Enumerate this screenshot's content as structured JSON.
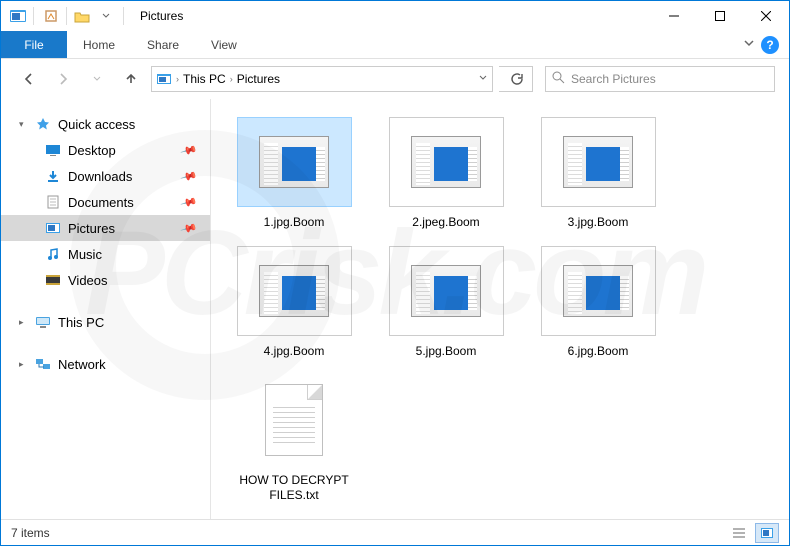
{
  "window": {
    "title": "Pictures"
  },
  "ribbon": {
    "file": "File",
    "tabs": [
      "Home",
      "Share",
      "View"
    ]
  },
  "breadcrumb": {
    "segments": [
      "This PC",
      "Pictures"
    ]
  },
  "search": {
    "placeholder": "Search Pictures"
  },
  "sidebar": {
    "quick_access": "Quick access",
    "items": [
      {
        "label": "Desktop",
        "pinned": true
      },
      {
        "label": "Downloads",
        "pinned": true
      },
      {
        "label": "Documents",
        "pinned": true
      },
      {
        "label": "Pictures",
        "pinned": true,
        "selected": true
      },
      {
        "label": "Music",
        "pinned": false
      },
      {
        "label": "Videos",
        "pinned": false
      }
    ],
    "this_pc": "This PC",
    "network": "Network"
  },
  "files": [
    {
      "name": "1.jpg.Boom",
      "kind": "app",
      "selected": true
    },
    {
      "name": "2.jpeg.Boom",
      "kind": "app"
    },
    {
      "name": "3.jpg.Boom",
      "kind": "app"
    },
    {
      "name": "4.jpg.Boom",
      "kind": "app"
    },
    {
      "name": "5.jpg.Boom",
      "kind": "app"
    },
    {
      "name": "6.jpg.Boom",
      "kind": "app"
    },
    {
      "name": "HOW TO DECRYPT FILES.txt",
      "kind": "txt"
    }
  ],
  "status": {
    "count_label": "7 items"
  },
  "watermark": "PCrisk.com"
}
